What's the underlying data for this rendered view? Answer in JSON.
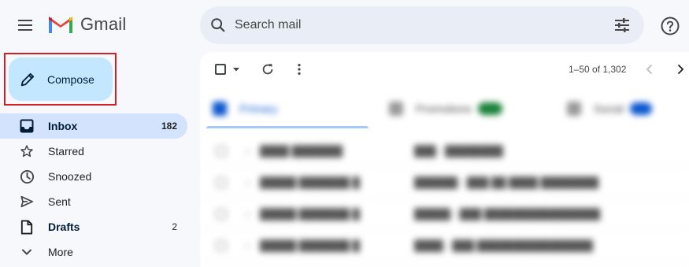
{
  "app": {
    "name": "Gmail"
  },
  "search": {
    "placeholder": "Search mail"
  },
  "compose": {
    "label": "Compose"
  },
  "nav": [
    {
      "label": "Inbox",
      "count": "182",
      "active": true,
      "icon": "inbox-icon"
    },
    {
      "label": "Starred",
      "count": "",
      "icon": "star-icon"
    },
    {
      "label": "Snoozed",
      "count": "",
      "icon": "clock-icon"
    },
    {
      "label": "Sent",
      "count": "",
      "icon": "send-icon"
    },
    {
      "label": "Drafts",
      "count": "2",
      "icon": "draft-icon"
    },
    {
      "label": "More",
      "count": "",
      "icon": "chevron-down-icon"
    }
  ],
  "toolbar": {
    "pagination": "1–50 of 1,302"
  },
  "tabs": [
    {
      "label": "Primary",
      "icon": "inbox-icon",
      "color": "#0b57d0"
    },
    {
      "label": "Promotions",
      "badge": "",
      "icon": "tag-icon",
      "color": "#188038"
    },
    {
      "label": "Social",
      "badge": "",
      "icon": "people-icon",
      "color": "#0b57d0"
    }
  ],
  "colors": {
    "accent": "#0b57d0",
    "compose_bg": "#c2e7ff",
    "active_nav": "#d3e3fd",
    "highlight": "#d21f25"
  }
}
